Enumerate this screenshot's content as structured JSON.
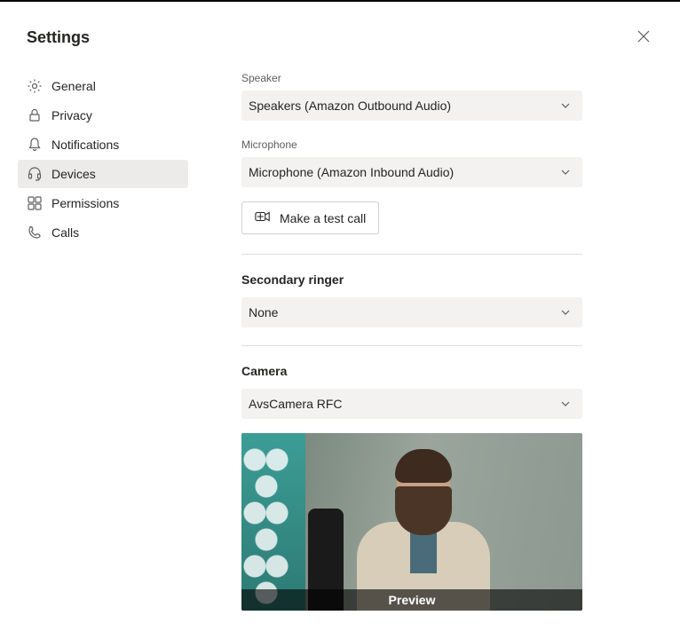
{
  "header": {
    "title": "Settings"
  },
  "sidebar": {
    "items": [
      {
        "id": "general",
        "label": "General",
        "icon": "gear-icon"
      },
      {
        "id": "privacy",
        "label": "Privacy",
        "icon": "lock-icon"
      },
      {
        "id": "notifications",
        "label": "Notifications",
        "icon": "bell-icon"
      },
      {
        "id": "devices",
        "label": "Devices",
        "icon": "headset-icon"
      },
      {
        "id": "permissions",
        "label": "Permissions",
        "icon": "app-icon"
      },
      {
        "id": "calls",
        "label": "Calls",
        "icon": "phone-icon"
      }
    ],
    "active": "devices"
  },
  "devices": {
    "speaker": {
      "label": "Speaker",
      "value": "Speakers (Amazon Outbound Audio)"
    },
    "microphone": {
      "label": "Microphone",
      "value": "Microphone (Amazon Inbound Audio)"
    },
    "test_call_label": "Make a test call",
    "secondary_ringer": {
      "label": "Secondary ringer",
      "value": "None"
    },
    "camera": {
      "label": "Camera",
      "value": "AvsCamera RFC",
      "preview_label": "Preview"
    }
  }
}
